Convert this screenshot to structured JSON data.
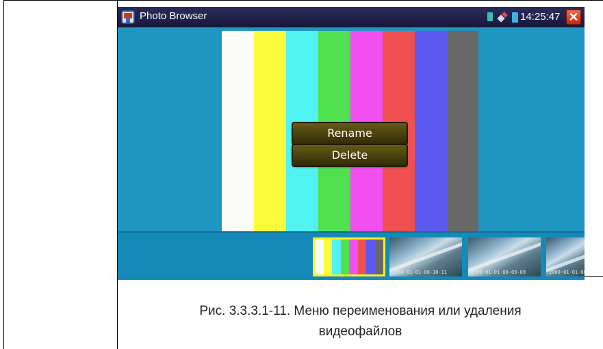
{
  "window": {
    "title": "Photo Browser",
    "clock": "14:25:47",
    "icons": [
      "home-app-icon",
      "sd-card-icon",
      "network-icon",
      "battery-icon",
      "close-icon"
    ],
    "close_glyph": "✕",
    "accent": "#1f95c2",
    "title_bar_color": "#1f1f4c"
  },
  "preview": {
    "bar_colors": [
      "#fafaf8",
      "#fbfb3c",
      "#52f2f2",
      "#50e050",
      "#f050f0",
      "#f05050",
      "#5a5af0",
      "#686868"
    ]
  },
  "context_menu": {
    "items": [
      {
        "label": "Rename"
      },
      {
        "label": "Delete"
      }
    ]
  },
  "thumbnails": {
    "selected_index": 0,
    "selected_border_color": "#ffef1e",
    "items": [
      {
        "timestamp": ""
      },
      {
        "timestamp": "2000-01-01-08-10-11"
      },
      {
        "timestamp": "2000-01-01-08-09-09"
      },
      {
        "timestamp": "2000-01-01-08"
      }
    ]
  },
  "caption": {
    "line1": "Рис. 3.3.3.1-11.  Меню переименования или удаления",
    "line2": "видеофайлов"
  }
}
